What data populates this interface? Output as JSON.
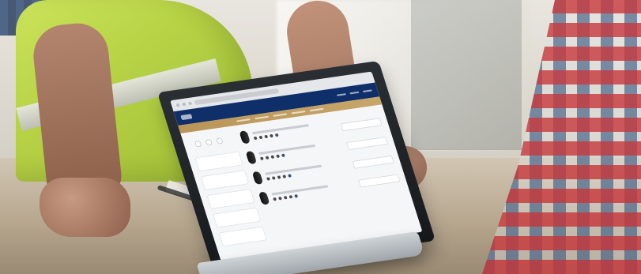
{
  "scene": {
    "colors": {
      "navy": "#0f2f6a",
      "gold": "#c7a66a",
      "vest": "#b7d245"
    }
  }
}
